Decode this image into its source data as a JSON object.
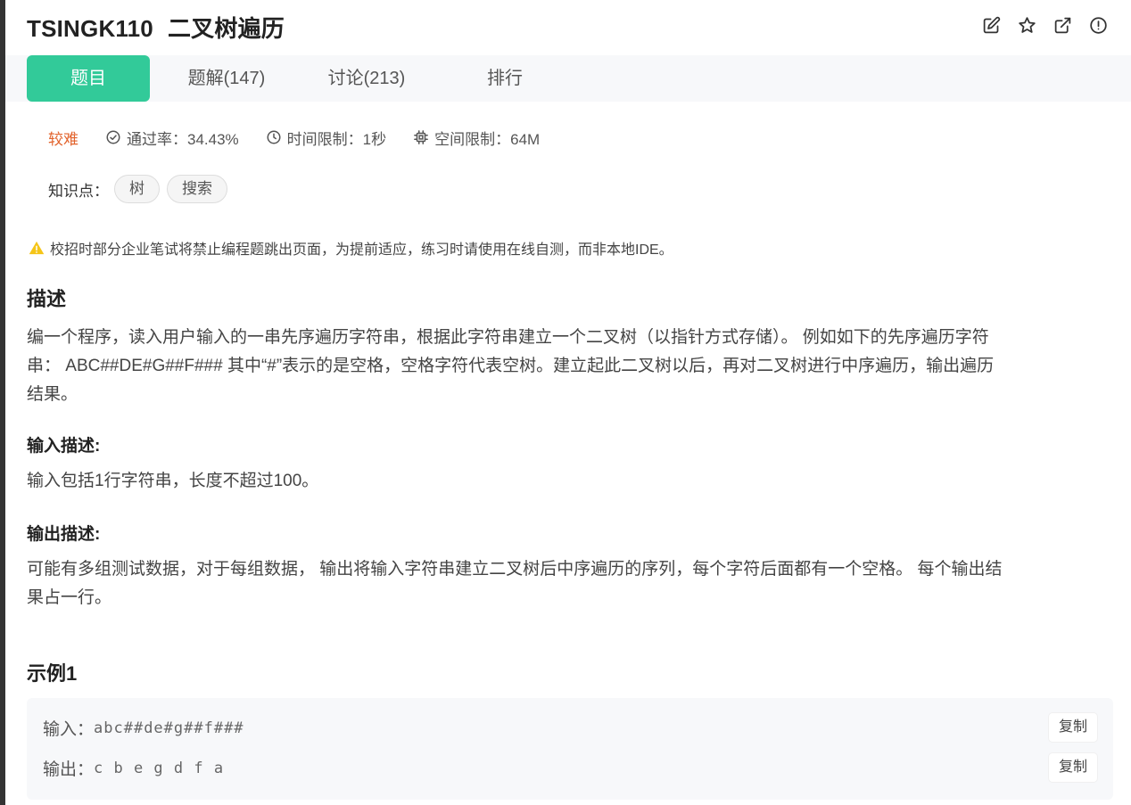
{
  "problem": {
    "code": "TSINGK110",
    "name": "二叉树遍历"
  },
  "header_icons": [
    "edit-icon",
    "star-icon",
    "external-link-icon",
    "report-icon"
  ],
  "tabs": [
    {
      "label": "题目",
      "active": true
    },
    {
      "label": "题解(147)",
      "active": false
    },
    {
      "label": "讨论(213)",
      "active": false
    },
    {
      "label": "排行",
      "active": false
    }
  ],
  "meta": {
    "difficulty": "较难",
    "pass_rate": "通过率：34.43%",
    "time_limit": "时间限制：1秒",
    "space_limit": "空间限制：64M"
  },
  "knowledge": {
    "label": "知识点：",
    "tags": [
      "树",
      "搜索"
    ]
  },
  "warning": "校招时部分企业笔试将禁止编程题跳出页面，为提前适应，练习时请使用在线自测，而非本地IDE。",
  "description": {
    "title": "描述",
    "line1": "编一个程序，读入用户输入的一串先序遍历字符串，根据此字符串建立一个二叉树（以指针方式存储）。 例如如下的先序遍历字符",
    "line2": "串： ABC##DE#G##F### 其中“#”表示的是空格，空格字符代表空树。建立起此二叉树以后，再对二叉树进行中序遍历，输出遍历",
    "line3": "结果。"
  },
  "input_desc": {
    "title": "输入描述:",
    "body": "输入包括1行字符串，长度不超过100。"
  },
  "output_desc": {
    "title": "输出描述:",
    "line1": "可能有多组测试数据，对于每组数据， 输出将输入字符串建立二叉树后中序遍历的序列，每个字符后面都有一个空格。 每个输出结",
    "line2": "果占一行。"
  },
  "example": {
    "title": "示例1",
    "input_label": "输入：",
    "input_value": "abc##de#g##f###",
    "output_label": "输出：",
    "output_value": "c b e g d f a",
    "copy_label": "复制"
  },
  "colors": {
    "accent": "#32ca99",
    "difficulty": "#e2622b",
    "warning": "#f5c518"
  }
}
